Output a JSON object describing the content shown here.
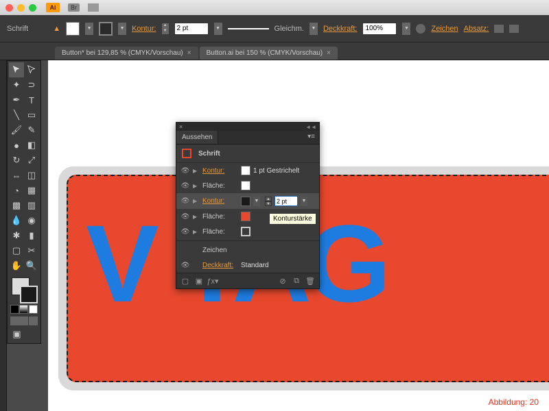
{
  "app_icon": "Ai",
  "bridge": "Br",
  "control": {
    "mode": "Schrift",
    "kontur_label": "Kontur:",
    "kontur_value": "2 pt",
    "stroke_style": "Gleichm.",
    "opacity_label": "Deckkraft:",
    "opacity_value": "100%",
    "char_link": "Zeichen",
    "para_link": "Absatz:"
  },
  "tabs": [
    {
      "label": "Button* bei 129,85 % (CMYK/Vorschau)"
    },
    {
      "label": "Button.ai bei 150 % (CMYK/Vorschau)"
    }
  ],
  "canvas_text": "V   TAG",
  "caption": "Abbildung: 20",
  "panel": {
    "title": "Aussehen",
    "obj": "Schrift",
    "rows": [
      {
        "label": "Kontur:",
        "swatch": "#ffffff",
        "value": "1 pt Gestrichelt",
        "link": true
      },
      {
        "label": "Fläche:",
        "swatch": "#ffffff",
        "link": false
      },
      {
        "label": "Kontur:",
        "swatch": "#1a1a1a",
        "editing": true,
        "edit_value": "2 pt",
        "link": true
      },
      {
        "label": "Fläche:",
        "swatch": "#e8482e",
        "link": false
      },
      {
        "label": "Fläche:",
        "swatch": "stroke",
        "link": false
      }
    ],
    "char": "Zeichen",
    "opacity_label": "Deckkraft:",
    "opacity_value": "Standard"
  },
  "tooltip": "Konturstärke"
}
